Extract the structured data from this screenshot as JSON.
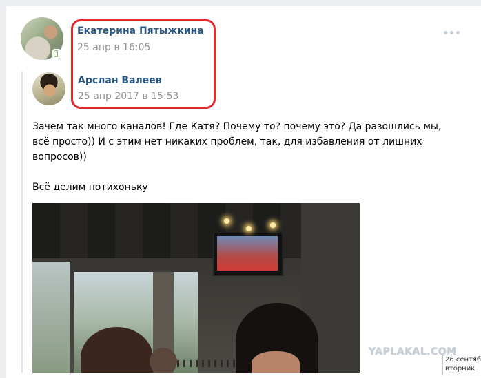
{
  "post": {
    "author_name": "Екатерина Пятыжкина",
    "author_date": "25 апр в 16:05",
    "more_icon": "more-horizontal-icon"
  },
  "repost": {
    "author_name": "Арслан Валеев",
    "author_date": "25 апр 2017 в 15:53",
    "text": "Зачем так много каналов! Где Катя? Почему то? почему это? Да разошлись мы,\nвсё просто)) И с этим нет никаких проблем, так, для избавления от лишних\nвопросов))\n\nВсё делим потихоньку"
  },
  "overlay": {
    "watermark": "YAPLAKAL.COM",
    "tooltip_line1": "26 сентябр",
    "tooltip_line2": "вторник"
  },
  "colors": {
    "link": "#2a5885",
    "meta": "#939393",
    "highlight": "#e3272a"
  }
}
